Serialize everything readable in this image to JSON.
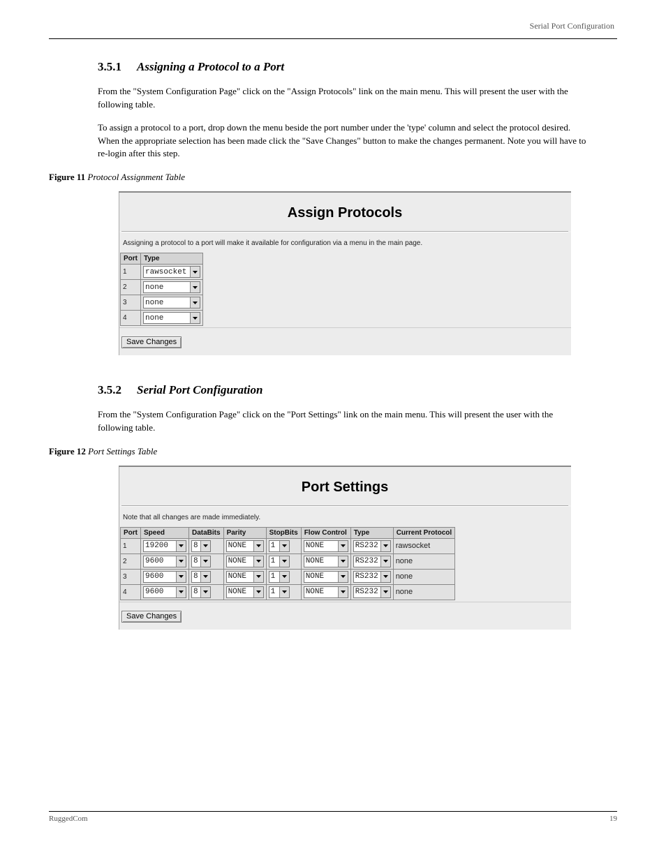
{
  "document": {
    "header_right": "Serial Port Configuration",
    "section1": {
      "num": "3.5.1",
      "title": "Assigning a Protocol to a Port",
      "para1": "From the \"System Configuration Page\" click on the \"Assign Protocols\" link on the main menu. This will present the user with the following table.",
      "para2": "To assign a protocol to a port, drop down the menu beside the port number under the 'type' column and select the protocol desired. When the appropriate selection has been made click the \"Save Changes\" button to make the changes permanent. Note you will have to re-login after this step."
    },
    "figure11": {
      "label": "Figure 11",
      "title": "Protocol Assignment Table"
    },
    "section2": {
      "num": "3.5.2",
      "title": "Serial Port Configuration",
      "para1": "From the \"System Configuration Page\" click on the \"Port Settings\" link on the main menu. This will present the user with the following table."
    },
    "figure12": {
      "label": "Figure 12",
      "title": "Port Settings Table"
    },
    "footer": {
      "left": "RuggedCom",
      "right": "19"
    }
  },
  "assign_panel": {
    "title": "Assign Protocols",
    "note": "Assigning a protocol to a port will make it available for configuration via a menu in the main page.",
    "columns": [
      "Port",
      "Type"
    ],
    "rows": [
      {
        "port": "1",
        "type": "rawsocket"
      },
      {
        "port": "2",
        "type": "none"
      },
      {
        "port": "3",
        "type": "none"
      },
      {
        "port": "4",
        "type": "none"
      }
    ],
    "save_label": "Save Changes"
  },
  "port_panel": {
    "title": "Port Settings",
    "note": "Note that all changes are made immediately.",
    "columns": [
      "Port",
      "Speed",
      "DataBits",
      "Parity",
      "StopBits",
      "Flow Control",
      "Type",
      "Current Protocol"
    ],
    "rows": [
      {
        "port": "1",
        "speed": "19200",
        "databits": "8",
        "parity": "NONE",
        "stopbits": "1",
        "flow": "NONE",
        "type": "RS232",
        "protocol": "rawsocket"
      },
      {
        "port": "2",
        "speed": "9600",
        "databits": "8",
        "parity": "NONE",
        "stopbits": "1",
        "flow": "NONE",
        "type": "RS232",
        "protocol": "none"
      },
      {
        "port": "3",
        "speed": "9600",
        "databits": "8",
        "parity": "NONE",
        "stopbits": "1",
        "flow": "NONE",
        "type": "RS232",
        "protocol": "none"
      },
      {
        "port": "4",
        "speed": "9600",
        "databits": "8",
        "parity": "NONE",
        "stopbits": "1",
        "flow": "NONE",
        "type": "RS232",
        "protocol": "none"
      }
    ],
    "save_label": "Save Changes",
    "widths": {
      "speed": 62,
      "databits": 28,
      "parity": 54,
      "stopbits": 30,
      "flow": 64,
      "type": 54
    }
  }
}
